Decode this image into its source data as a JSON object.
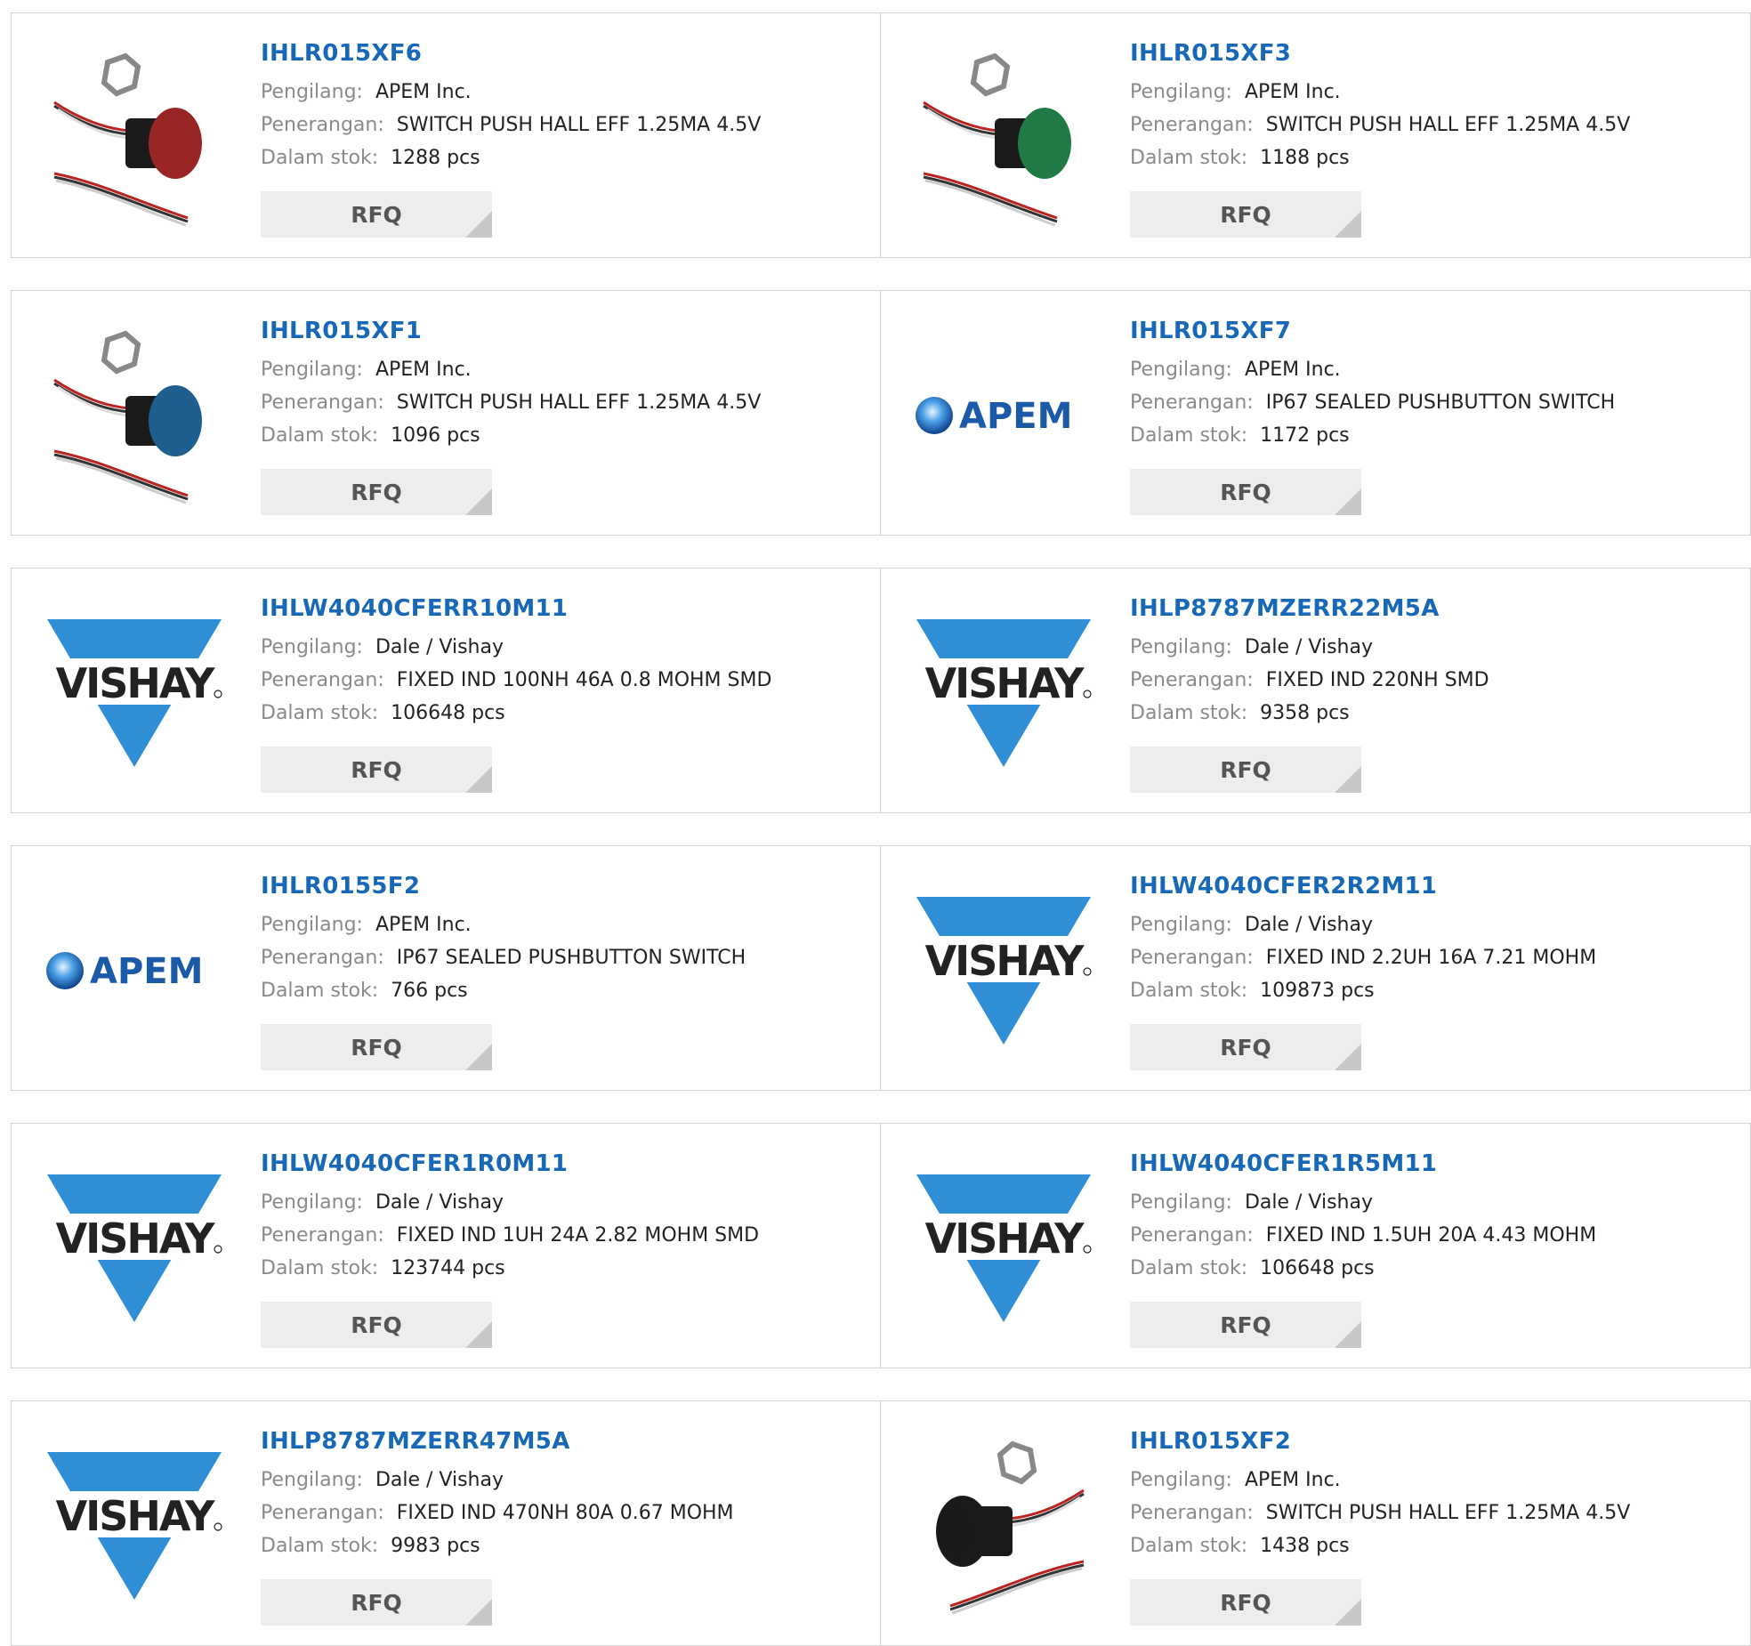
{
  "labels": {
    "manufacturer": "Pengilang:",
    "description": "Penerangan:",
    "stock": "Dalam stok:",
    "rfq": "RFQ"
  },
  "colors": {
    "part_link": "#1769b8",
    "label_gray": "#8a8a8a",
    "vishay_blue": "#2f8fd6",
    "apem_blue": "#1a5aa8",
    "rfq_bg": "#ededed"
  },
  "products": [
    {
      "part": "IHLR015XF6",
      "manufacturer": "APEM Inc.",
      "description": "SWITCH PUSH HALL EFF 1.25MA 4.5V",
      "stock": "1288 pcs",
      "image": "switch-red-icon"
    },
    {
      "part": "IHLR015XF3",
      "manufacturer": "APEM Inc.",
      "description": "SWITCH PUSH HALL EFF 1.25MA 4.5V",
      "stock": "1188 pcs",
      "image": "switch-green-icon"
    },
    {
      "part": "IHLR015XF1",
      "manufacturer": "APEM Inc.",
      "description": "SWITCH PUSH HALL EFF 1.25MA 4.5V",
      "stock": "1096 pcs",
      "image": "switch-blue-icon"
    },
    {
      "part": "IHLR015XF7",
      "manufacturer": "APEM Inc.",
      "description": "IP67 SEALED PUSHBUTTON SWITCH",
      "stock": "1172 pcs",
      "image": "apem-logo"
    },
    {
      "part": "IHLW4040CFERR10M11",
      "manufacturer": "Dale / Vishay",
      "description": "FIXED IND 100NH 46A 0.8 MOHM SMD",
      "stock": "106648 pcs",
      "image": "vishay-logo"
    },
    {
      "part": "IHLP8787MZERR22M5A",
      "manufacturer": "Dale / Vishay",
      "description": "FIXED IND 220NH SMD",
      "stock": "9358 pcs",
      "image": "vishay-logo"
    },
    {
      "part": "IHLR0155F2",
      "manufacturer": "APEM Inc.",
      "description": "IP67 SEALED PUSHBUTTON SWITCH",
      "stock": "766 pcs",
      "image": "apem-logo"
    },
    {
      "part": "IHLW4040CFER2R2M11",
      "manufacturer": "Dale / Vishay",
      "description": "FIXED IND 2.2UH 16A 7.21 MOHM",
      "stock": "109873 pcs",
      "image": "vishay-logo"
    },
    {
      "part": "IHLW4040CFER1R0M11",
      "manufacturer": "Dale / Vishay",
      "description": "FIXED IND 1UH 24A 2.82 MOHM SMD",
      "stock": "123744 pcs",
      "image": "vishay-logo"
    },
    {
      "part": "IHLW4040CFER1R5M11",
      "manufacturer": "Dale / Vishay",
      "description": "FIXED IND 1.5UH 20A 4.43 MOHM",
      "stock": "106648 pcs",
      "image": "vishay-logo"
    },
    {
      "part": "IHLP8787MZERR47M5A",
      "manufacturer": "Dale / Vishay",
      "description": "FIXED IND 470NH 80A 0.67 MOHM",
      "stock": "9983 pcs",
      "image": "vishay-logo"
    },
    {
      "part": "IHLR015XF2",
      "manufacturer": "APEM Inc.",
      "description": "SWITCH PUSH HALL EFF 1.25MA 4.5V",
      "stock": "1438 pcs",
      "image": "switch-black-icon"
    }
  ],
  "logo_text": {
    "vishay": "VISHAY",
    "apem": "APEM"
  }
}
